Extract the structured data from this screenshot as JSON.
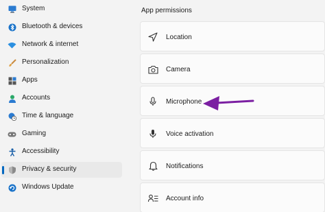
{
  "sidebar": {
    "items": [
      {
        "label": "System",
        "icon": "monitor-icon"
      },
      {
        "label": "Bluetooth & devices",
        "icon": "bluetooth-icon"
      },
      {
        "label": "Network & internet",
        "icon": "wifi-icon"
      },
      {
        "label": "Personalization",
        "icon": "brush-icon"
      },
      {
        "label": "Apps",
        "icon": "apps-icon"
      },
      {
        "label": "Accounts",
        "icon": "person-icon"
      },
      {
        "label": "Time & language",
        "icon": "globe-clock-icon"
      },
      {
        "label": "Gaming",
        "icon": "gamepad-icon"
      },
      {
        "label": "Accessibility",
        "icon": "accessibility-icon"
      },
      {
        "label": "Privacy & security",
        "icon": "shield-icon",
        "selected": true
      },
      {
        "label": "Windows Update",
        "icon": "update-icon"
      }
    ]
  },
  "main": {
    "section_title": "App permissions",
    "permissions": [
      {
        "label": "Location",
        "icon": "location-arrow-icon"
      },
      {
        "label": "Camera",
        "icon": "camera-icon"
      },
      {
        "label": "Microphone",
        "icon": "microphone-icon",
        "highlighted_by_arrow": true
      },
      {
        "label": "Voice activation",
        "icon": "voice-microphone-icon"
      },
      {
        "label": "Notifications",
        "icon": "bell-icon"
      },
      {
        "label": "Account info",
        "icon": "account-info-icon"
      }
    ]
  },
  "colors": {
    "accent": "#0067c0",
    "annotation_arrow": "#7b1fa2"
  }
}
